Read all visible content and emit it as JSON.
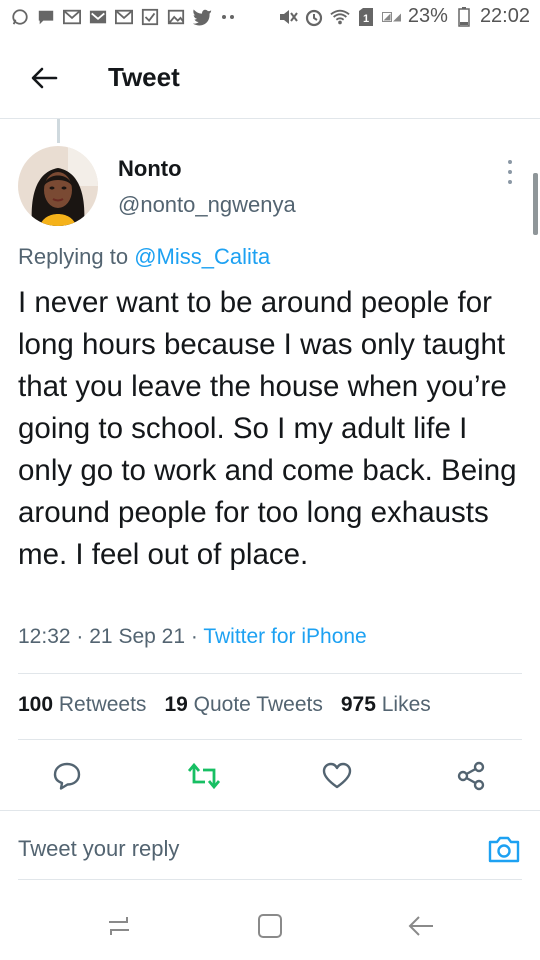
{
  "status_bar": {
    "battery": "23%",
    "time": "22:02",
    "icons": [
      "whatsapp-icon",
      "messages-icon",
      "gmail-icon",
      "email-icon",
      "gmail-icon",
      "checkbox-icon",
      "gallery-icon",
      "twitter-icon",
      "more-dots-icon",
      "mute-icon",
      "alarm-icon",
      "wifi-icon",
      "sim1-icon",
      "signal-icon",
      "battery-icon"
    ]
  },
  "header": {
    "title": "Tweet",
    "back_icon": "arrow-left-icon"
  },
  "tweet": {
    "author_name": "Nonto",
    "author_handle": "@nonto_ngwenya",
    "replying_prefix": "Replying to",
    "replying_to": "@Miss_Calita",
    "text": "I never want to be around people for long hours because I was only taught that you leave the house when you’re going to school. So I my adult life I only go to work and come back. Being around people for too long exhausts me. I feel out of place.",
    "time": "12:32",
    "date": "21 Sep 21",
    "separator": "·",
    "source": "Twitter for iPhone"
  },
  "stats": {
    "retweets_count": "100",
    "retweets_label": "Retweets",
    "quotes_count": "19",
    "quotes_label": "Quote Tweets",
    "likes_count": "975",
    "likes_label": "Likes"
  },
  "actions": {
    "reply_icon": "comment-icon",
    "retweet_icon": "retweet-icon",
    "like_icon": "heart-icon",
    "share_icon": "share-icon",
    "retweet_color": "#17bf63"
  },
  "compose": {
    "placeholder": "Tweet your reply",
    "camera_icon": "camera-icon"
  },
  "colors": {
    "accent": "#1da1f2",
    "text": "#14171a",
    "muted": "#536471"
  }
}
